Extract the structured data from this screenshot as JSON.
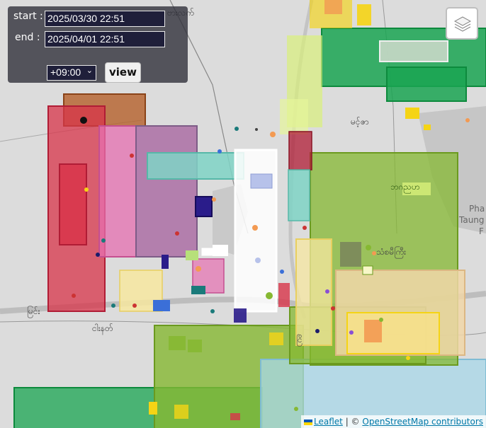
{
  "controls": {
    "start_label": "start :",
    "start_value": "2025/03/30 22:51",
    "end_label": "end :",
    "end_value": "2025/04/01 22:51",
    "timezone_value": "+09:00",
    "view_label": "view"
  },
  "map_labels": {
    "top_town": "ဗားလက်",
    "mid_town": "မင့်ဇာ",
    "city": "သံစမီကြီး",
    "left_town": "မြင်း",
    "bottom_left_town": "ငါးနတ်",
    "bottom_mid": "ငြိ",
    "pale_label": "ဘဂညဟ",
    "phataung_1": "Pha",
    "phataung_2": "Taung",
    "phataung_3": "F"
  },
  "layers_icon": "layers-icon",
  "attribution": {
    "leaflet": "Leaflet",
    "separator": " | © ",
    "osm": "OpenStreetMap contributors"
  },
  "colors": {
    "red": "#d8344a",
    "pink": "#e56fb0",
    "brown": "#b5602a",
    "teal": "#7fd4c6",
    "olive": "#86b832",
    "green": "#1aa552",
    "blue": "#a8d8ea",
    "yellow": "#f5d415",
    "lime": "#d8f07a",
    "white": "#ffffff"
  }
}
